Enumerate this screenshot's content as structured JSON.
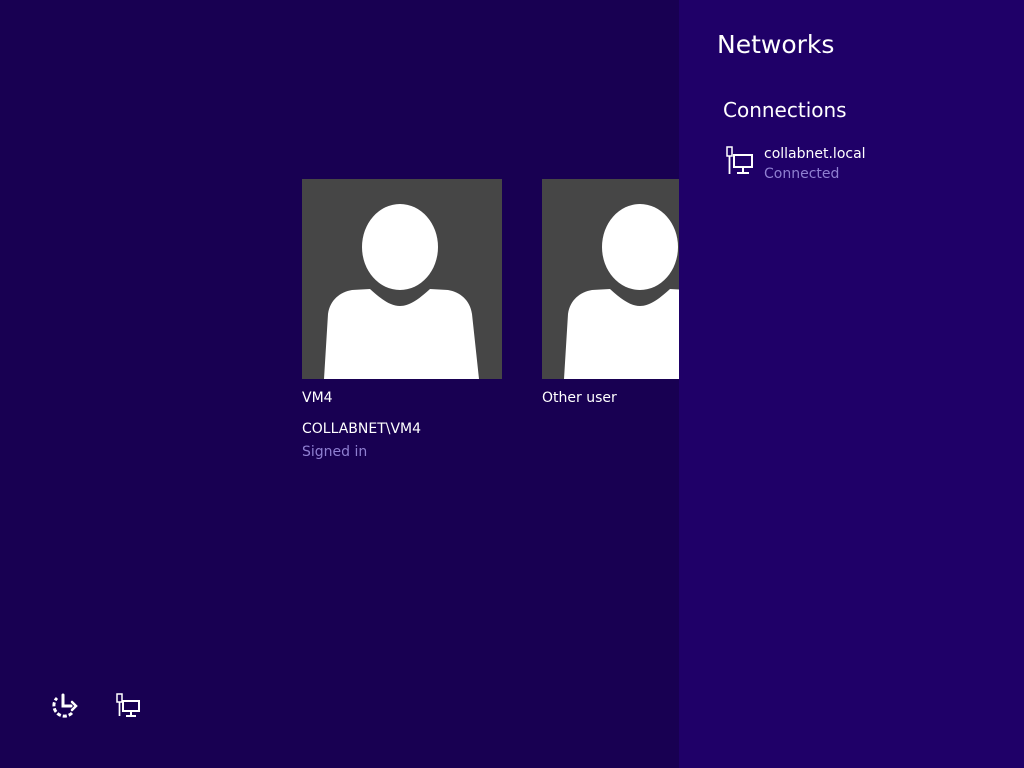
{
  "users": [
    {
      "name": "VM4",
      "account": "COLLABNET\\VM4",
      "status": "Signed in",
      "avatar_icon": "user-silhouette-icon"
    },
    {
      "name": "Other user",
      "avatar_icon": "user-silhouette-icon"
    }
  ],
  "bottom_controls": {
    "ease_of_access_icon": "ease-of-access-icon",
    "network_icon": "wired-network-icon"
  },
  "networks_panel": {
    "title": "Networks",
    "section": "Connections",
    "connections": [
      {
        "name": "collabnet.local",
        "status": "Connected",
        "icon": "wired-network-icon"
      }
    ]
  },
  "colors": {
    "background": "#180052",
    "charm_background": "#1f0068",
    "avatar_background": "#464646",
    "muted_text": "#8f7fd1",
    "text": "#ffffff"
  }
}
